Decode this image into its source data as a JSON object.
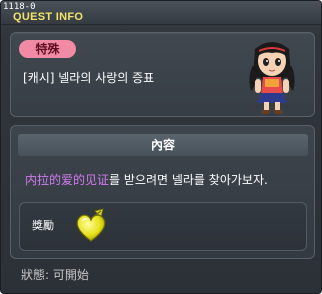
{
  "window": {
    "version": "1118-0",
    "title": "QUEST INFO"
  },
  "quest": {
    "badge": "特殊",
    "name": "[캐시] 넬라의 사랑의 증표",
    "character_icon": "npc-girl-portrait"
  },
  "content": {
    "header": "內容",
    "highlight_text": "内拉的爱的见证",
    "rest_text": "를 받으려면 넬라를 찾아가보자."
  },
  "reward": {
    "label": "獎勵",
    "item_icon": "heart-token-icon"
  },
  "status": {
    "text": "狀態:  可開始"
  },
  "colors": {
    "title_yellow": "#f2e46d",
    "badge_pink": "#f08aa5",
    "highlight_purple": "#d27cf0"
  }
}
